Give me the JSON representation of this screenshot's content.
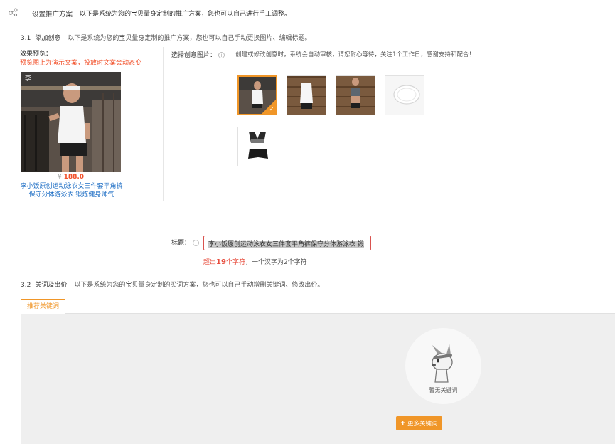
{
  "header": {
    "title": "设置推广方案",
    "desc": "以下是系统为您的宝贝量身定制的推广方案，您也可以自己进行手工调整。"
  },
  "creative_section": {
    "num": "3.1",
    "label": "添加创意",
    "desc": "以下是系统为您的宝贝量身定制的推广方案，您也可以自己手动更换图片、编辑标题。"
  },
  "preview": {
    "label": "效果预览：",
    "note": "预览图上为演示文案，投放时文案会动态变",
    "price_symbol": "¥",
    "price": "188.0",
    "product_title": "李小饭原创运动泳衣女三件套平角裤保守分体游泳衣 锻炼健身帅气"
  },
  "image_picker": {
    "label": "选择创意图片：",
    "info": "i",
    "tip": "创建或修改创意时，系统会自动审核，请您耐心等待，关注1个工作日，感谢支持和配合！",
    "check": "✓"
  },
  "title_field": {
    "label": "标题：",
    "info": "i",
    "value": "李小饭原创运动泳衣女三件套平角裤保守分体游泳衣 锻",
    "warn_prefix": "超出",
    "warn_count": "19",
    "warn_unit": "个字符",
    "warn_suffix": "，一个汉字为2个字符"
  },
  "keyword_section": {
    "num": "3.2",
    "label": "关词及出价",
    "desc": "以下是系统为您的宝贝量身定制的买词方案，您也可以自己手动增删关键词、修改出价。",
    "tab": "推荐关键词",
    "empty_text": "暂无关键词",
    "more_plus": "+",
    "more_label": "更多关键词"
  }
}
